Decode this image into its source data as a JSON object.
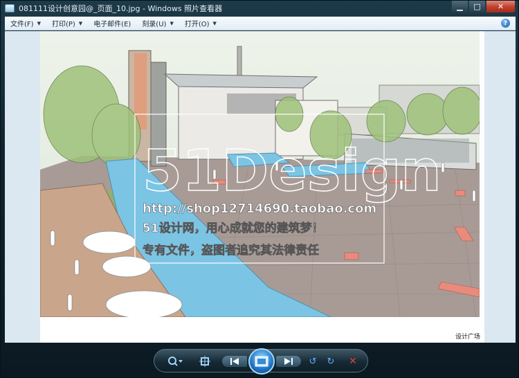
{
  "window": {
    "title": "081111设计创意园@_页面_10.jpg - Windows 照片查看器",
    "minimize": "▁",
    "maximize": "□",
    "close": "✕"
  },
  "menu": {
    "items": [
      {
        "label": "文件(F)"
      },
      {
        "label": "打印(P)"
      },
      {
        "label": "电子邮件(E)"
      },
      {
        "label": "刻录(U)"
      },
      {
        "label": "打开(O)"
      }
    ],
    "help": "?"
  },
  "image": {
    "watermark_url": "http://shop12714690.taobao.com",
    "watermark_line1": "51设计网，用心成就您的建筑梦！",
    "watermark_line2": "专有文件，盗图者追究其法律责任",
    "watermark_logo": "51Design",
    "caption": "设计广场"
  },
  "controls": {
    "zoom": "search-zoom-icon",
    "fit": "actual-size-icon",
    "prev": "previous-icon",
    "slideshow": "slideshow-icon",
    "next": "next-icon",
    "rotate_left": "rotate-ccw-icon",
    "rotate_right": "rotate-cw-icon",
    "delete": "delete-icon"
  }
}
